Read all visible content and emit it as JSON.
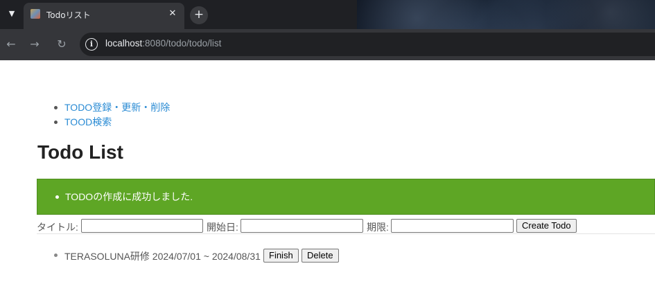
{
  "browser": {
    "tab": {
      "title": "Todoリスト"
    },
    "address": {
      "host": "localhost",
      "path": ":8080/todo/todo/list"
    }
  },
  "nav": {
    "items": [
      {
        "label": "TODO登録・更新・削除"
      },
      {
        "label": "TOOD検索"
      }
    ]
  },
  "page": {
    "title": "Todo List"
  },
  "alert": {
    "message": "TODOの作成に成功しました."
  },
  "form": {
    "title_label": "タイトル:",
    "title_value": "",
    "start_label": "開始日:",
    "start_value": "",
    "due_label": "期限:",
    "due_value": "",
    "create_label": "Create Todo"
  },
  "todos": [
    {
      "text": "TERASOLUNA研修 2024/07/01 ~ 2024/08/31",
      "finish_label": "Finish",
      "delete_label": "Delete"
    }
  ],
  "colors": {
    "alert_bg": "#5ea625",
    "link": "#2a8bd4",
    "chrome_bg": "#35363a"
  }
}
